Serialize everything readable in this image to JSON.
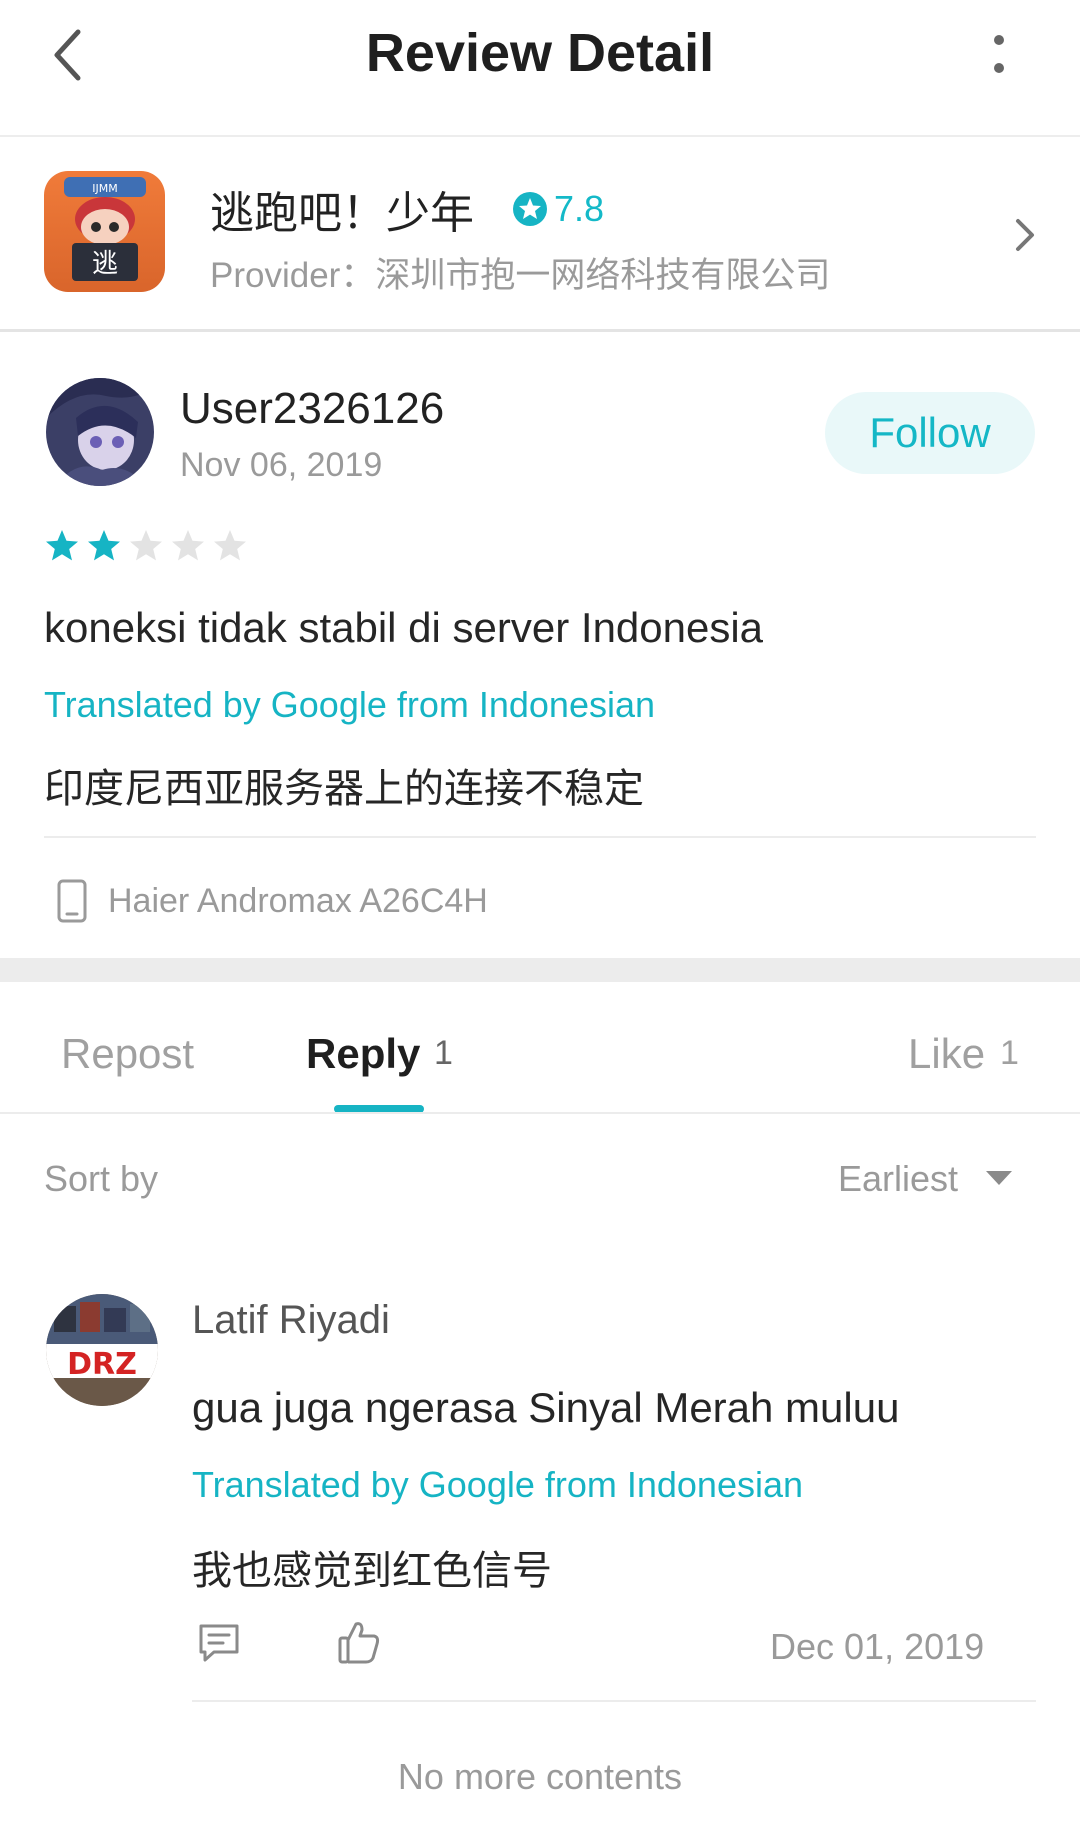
{
  "header": {
    "title": "Review Detail",
    "back_icon": "chevron-left-icon",
    "more_icon": "more-vertical-icon"
  },
  "app": {
    "name": "逃跑吧！少年",
    "score": "7.8",
    "provider": "Provider：深圳市抱一网络科技有限公司",
    "icon_badge": "逃",
    "icon_banner": "IJMM"
  },
  "review": {
    "user": "User2326126",
    "date": "Nov 06, 2019",
    "follow_label": "Follow",
    "rating": 2,
    "rating_max": 5,
    "text": "koneksi tidak stabil di server Indonesia",
    "translated_note": "Translated by Google from Indonesian",
    "translation": "印度尼西亚服务器上的连接不稳定",
    "device": "Haier Andromax A26C4H"
  },
  "tabs": {
    "repost": "Repost",
    "reply": "Reply",
    "reply_count": "1",
    "like": "Like",
    "like_count": "1"
  },
  "sort": {
    "label": "Sort by",
    "value": "Earliest"
  },
  "reply": {
    "user": "Latif Riyadi",
    "text": "gua juga ngerasa Sinyal Merah muluu",
    "translated_note": "Translated by Google from Indonesian",
    "translation": "我也感觉到红色信号",
    "date": "Dec 01, 2019",
    "avatar_text": "DRZ"
  },
  "footer": {
    "no_more": "No more contents"
  },
  "colors": {
    "accent": "#16b4c4",
    "muted": "#9a9a9a",
    "star_off": "#e3e3e3"
  }
}
